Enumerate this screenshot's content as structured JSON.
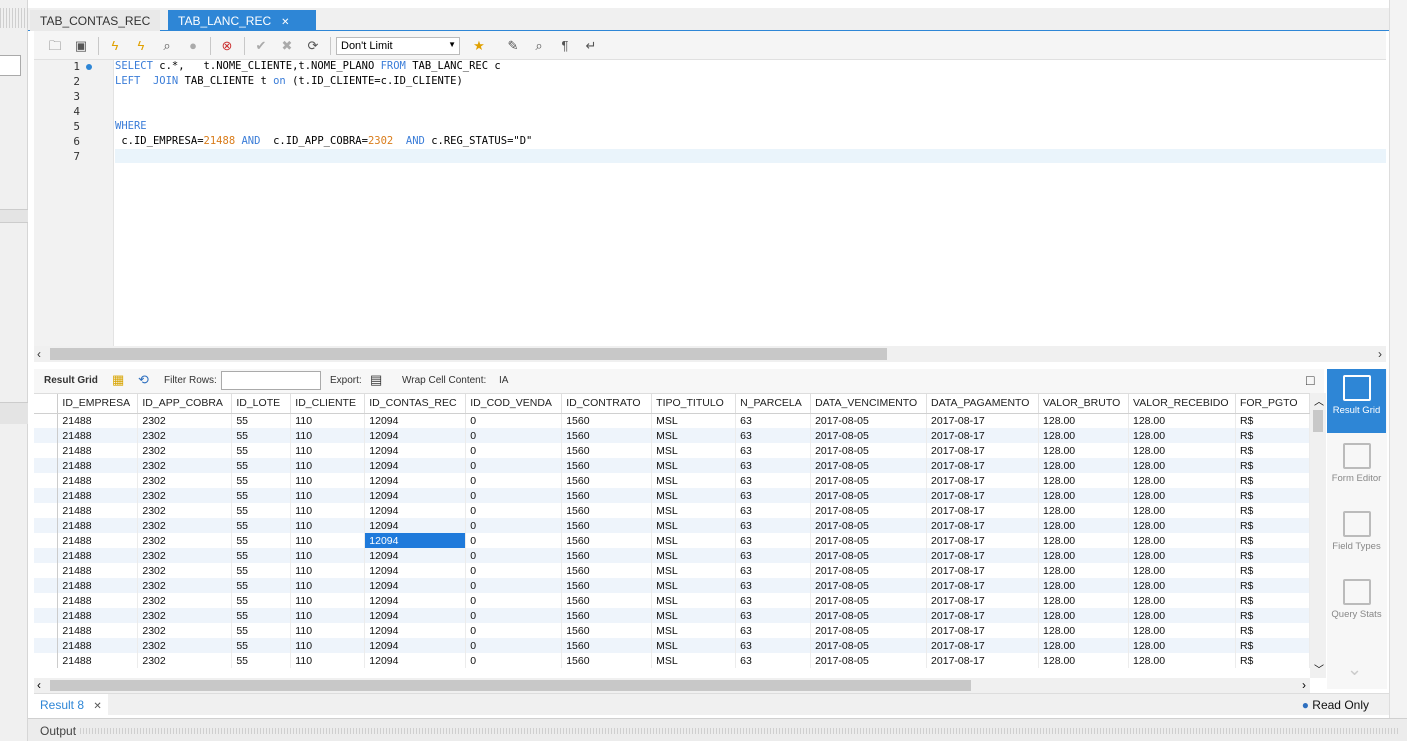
{
  "tabs": [
    {
      "label": "TAB_CONTAS_REC"
    },
    {
      "label": "TAB_LANC_REC",
      "close": "✕"
    }
  ],
  "toolbar": {
    "limit": "Don't Limit"
  },
  "editor": {
    "line_numbers": [
      "1",
      "2",
      "3",
      "4",
      "5",
      "6",
      "7"
    ],
    "lines": [
      "SELECT c.*,   t.NOME_CLIENTE,t.NOME_PLANO FROM TAB_LANC_REC c",
      "LEFT  JOIN TAB_CLIENTE t on (t.ID_CLIENTE=c.ID_CLIENTE)",
      "",
      "",
      "WHERE",
      " c.ID_EMPRESA=21488 AND  c.ID_APP_COBRA=2302  AND c.REG_STATUS=\"D\"",
      ""
    ]
  },
  "resultbar": {
    "result_grid": "Result Grid",
    "filter_rows": "Filter Rows:",
    "export": "Export:",
    "wrap": "Wrap Cell Content:"
  },
  "grid": {
    "columns": [
      "ID_EMPRESA",
      "ID_APP_COBRA",
      "ID_LOTE",
      "ID_CLIENTE",
      "ID_CONTAS_REC",
      "ID_COD_VENDA",
      "ID_CONTRATO",
      "TIPO_TITULO",
      "N_PARCELA",
      "DATA_VENCIMENTO",
      "DATA_PAGAMENTO",
      "VALOR_BRUTO",
      "VALOR_RECEBIDO",
      "FOR_PGTO"
    ],
    "row": [
      "21488",
      "2302",
      "55",
      "110",
      "12094",
      "0",
      "1560",
      "MSL",
      "63",
      "2017-08-05",
      "2017-08-17",
      "128.00",
      "128.00",
      "R$"
    ],
    "row_count": 17,
    "selected_row": 8,
    "selected_col": 4
  },
  "side": {
    "result_grid": "Result Grid",
    "form_editor": "Form Editor",
    "field_types": "Field Types",
    "query_stats": "Query Stats"
  },
  "bottom": {
    "result_tab": "Result 8",
    "close": "✕",
    "read_only": "Read Only",
    "output": "Output"
  }
}
